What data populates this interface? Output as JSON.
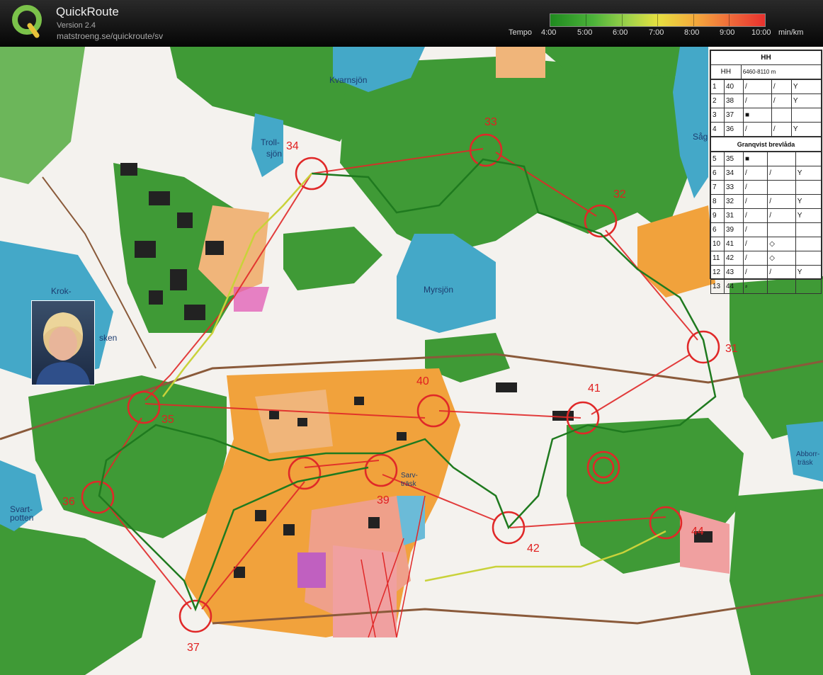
{
  "app": {
    "name": "QuickRoute",
    "version": "Version 2.4",
    "url": "matstroeng.se/quickroute/sv"
  },
  "tempo": {
    "label": "Tempo",
    "ticks": [
      "4:00",
      "5:00",
      "6:00",
      "7:00",
      "8:00",
      "9:00",
      "10:00"
    ],
    "unit": "min/km",
    "colors": [
      "#1f8a1f",
      "#4cb33a",
      "#9ed24a",
      "#e6e040",
      "#f4a83c",
      "#ef6a3a",
      "#e8312e"
    ]
  },
  "map": {
    "place_names": [
      "Kvarnsjön",
      "Troll-",
      "sjön",
      "Myrsjön",
      "Såg",
      "Krok-",
      "sken",
      "Svart-",
      "potten",
      "Abborr-",
      "träsk",
      "Sarv-",
      "träsk"
    ],
    "controls": [
      "34",
      "33",
      "32",
      "31",
      "41",
      "40",
      "35",
      "39",
      "36",
      "37",
      "42",
      "44"
    ]
  },
  "legend": {
    "class_title": "HH",
    "course": "HH",
    "distance": "6460-8110 m",
    "section_title": "Granqvist brevlåda",
    "rows": [
      {
        "n": "1",
        "code": "40",
        "symbols": [
          "/",
          "/",
          "Y"
        ]
      },
      {
        "n": "2",
        "code": "38",
        "symbols": [
          "/",
          "/",
          "Y"
        ]
      },
      {
        "n": "3",
        "code": "37",
        "symbols": [
          "■",
          "",
          ""
        ]
      },
      {
        "n": "4",
        "code": "36",
        "symbols": [
          "/",
          "/",
          "Y"
        ]
      },
      {
        "n": "5",
        "code": "35",
        "symbols": [
          "■",
          "",
          ""
        ]
      },
      {
        "n": "6",
        "code": "34",
        "symbols": [
          "/",
          "/",
          "Y"
        ]
      },
      {
        "n": "7",
        "code": "33",
        "symbols": [
          "/",
          "",
          ""
        ]
      },
      {
        "n": "8",
        "code": "32",
        "symbols": [
          "/",
          "/",
          "Y"
        ]
      },
      {
        "n": "9",
        "code": "31",
        "symbols": [
          "/",
          "/",
          "Y"
        ]
      },
      {
        "n": "6",
        "code": "39",
        "symbols": [
          "/",
          "",
          ""
        ]
      },
      {
        "n": "10",
        "code": "41",
        "symbols": [
          "/",
          "◇",
          ""
        ]
      },
      {
        "n": "11",
        "code": "42",
        "symbols": [
          "/",
          "◇",
          ""
        ]
      },
      {
        "n": "12",
        "code": "43",
        "symbols": [
          "/",
          "/",
          "Y"
        ]
      },
      {
        "n": "13",
        "code": "44",
        "symbols": [
          "⸗",
          "",
          ""
        ]
      }
    ]
  }
}
